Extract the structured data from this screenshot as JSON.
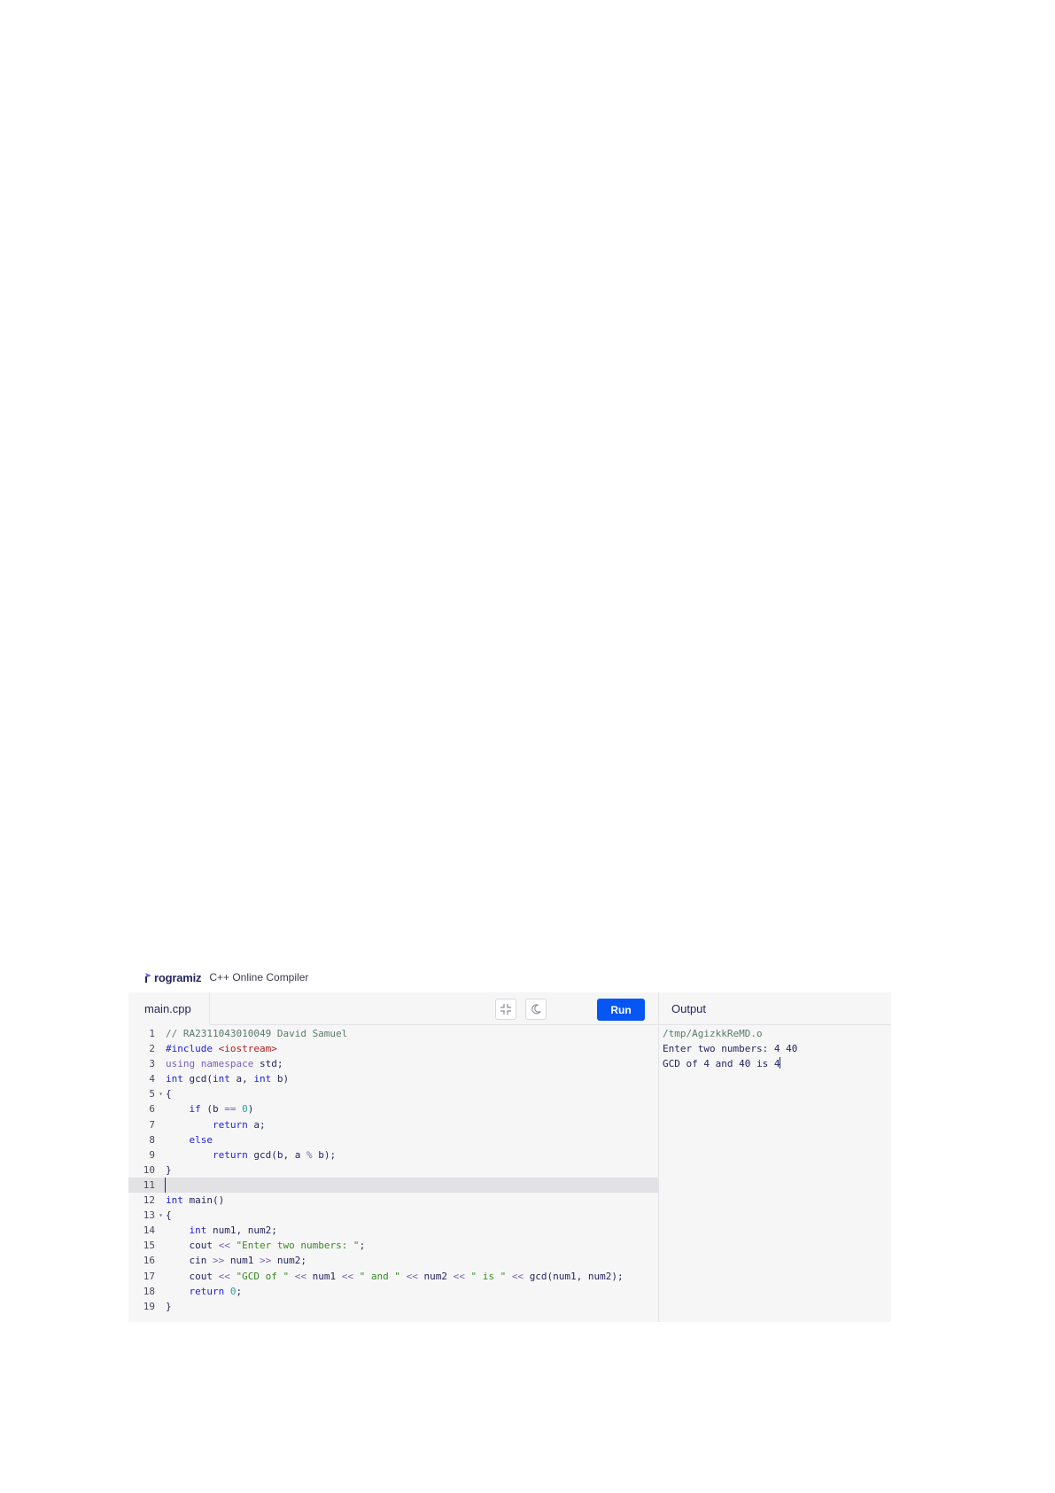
{
  "brand": {
    "logo_text": "rogramiz",
    "subtitle": "C++ Online Compiler"
  },
  "editor": {
    "file_tab": "main.cpp",
    "tools": {
      "fullscreen_icon": "collapse-icon",
      "theme_icon": "moon-icon"
    },
    "run_label": "Run",
    "active_line": 11,
    "lines": [
      [
        {
          "t": "// RA2311043010049 David Samuel",
          "c": "cm"
        }
      ],
      [
        {
          "t": "#include ",
          "c": "kw"
        },
        {
          "t": "<iostream>",
          "c": "inc"
        }
      ],
      [
        {
          "t": "using ",
          "c": "kw2"
        },
        {
          "t": "namespace ",
          "c": "kw2"
        },
        {
          "t": "std;"
        }
      ],
      [
        {
          "t": "int ",
          "c": "kw"
        },
        {
          "t": "gcd("
        },
        {
          "t": "int ",
          "c": "kw"
        },
        {
          "t": "a, "
        },
        {
          "t": "int ",
          "c": "kw"
        },
        {
          "t": "b)"
        }
      ],
      [
        {
          "t": "{"
        }
      ],
      [
        {
          "t": "    "
        },
        {
          "t": "if ",
          "c": "kw"
        },
        {
          "t": "(b "
        },
        {
          "t": "== ",
          "c": "op"
        },
        {
          "t": "0",
          "c": "num"
        },
        {
          "t": ")"
        }
      ],
      [
        {
          "t": "        "
        },
        {
          "t": "return ",
          "c": "kw"
        },
        {
          "t": "a;"
        }
      ],
      [
        {
          "t": "    "
        },
        {
          "t": "else",
          "c": "kw"
        }
      ],
      [
        {
          "t": "        "
        },
        {
          "t": "return ",
          "c": "kw"
        },
        {
          "t": "gcd(b, a "
        },
        {
          "t": "% ",
          "c": "op"
        },
        {
          "t": "b);"
        }
      ],
      [
        {
          "t": "}"
        }
      ],
      [
        {
          "t": ""
        }
      ],
      [
        {
          "t": "int ",
          "c": "kw"
        },
        {
          "t": "main()"
        }
      ],
      [
        {
          "t": "{"
        }
      ],
      [
        {
          "t": "    "
        },
        {
          "t": "int ",
          "c": "kw"
        },
        {
          "t": "num1, num2;"
        }
      ],
      [
        {
          "t": "    cout "
        },
        {
          "t": "<< ",
          "c": "op"
        },
        {
          "t": "\"Enter two numbers: \"",
          "c": "str"
        },
        {
          "t": ";"
        }
      ],
      [
        {
          "t": "    cin "
        },
        {
          "t": ">> ",
          "c": "op"
        },
        {
          "t": "num1 "
        },
        {
          "t": ">> ",
          "c": "op"
        },
        {
          "t": "num2;"
        }
      ],
      [
        {
          "t": "    cout "
        },
        {
          "t": "<< ",
          "c": "op"
        },
        {
          "t": "\"GCD of \" ",
          "c": "str"
        },
        {
          "t": "<< ",
          "c": "op"
        },
        {
          "t": "num1 "
        },
        {
          "t": "<< ",
          "c": "op"
        },
        {
          "t": "\" and \" ",
          "c": "str"
        },
        {
          "t": "<< ",
          "c": "op"
        },
        {
          "t": "num2 "
        },
        {
          "t": "<< ",
          "c": "op"
        },
        {
          "t": "\" is \" ",
          "c": "str"
        },
        {
          "t": "<< ",
          "c": "op"
        },
        {
          "t": "gcd(num1, num2);"
        }
      ],
      [
        {
          "t": "    "
        },
        {
          "t": "return ",
          "c": "kw"
        },
        {
          "t": "0",
          "c": "num"
        },
        {
          "t": ";"
        }
      ],
      [
        {
          "t": "}"
        }
      ]
    ],
    "fold_lines": [
      5,
      13
    ]
  },
  "output": {
    "header": "Output",
    "path": "/tmp/AgizkkReMD.o",
    "line1": "Enter two numbers: 4 40",
    "line2": "GCD of 4 and 40 is 4"
  }
}
